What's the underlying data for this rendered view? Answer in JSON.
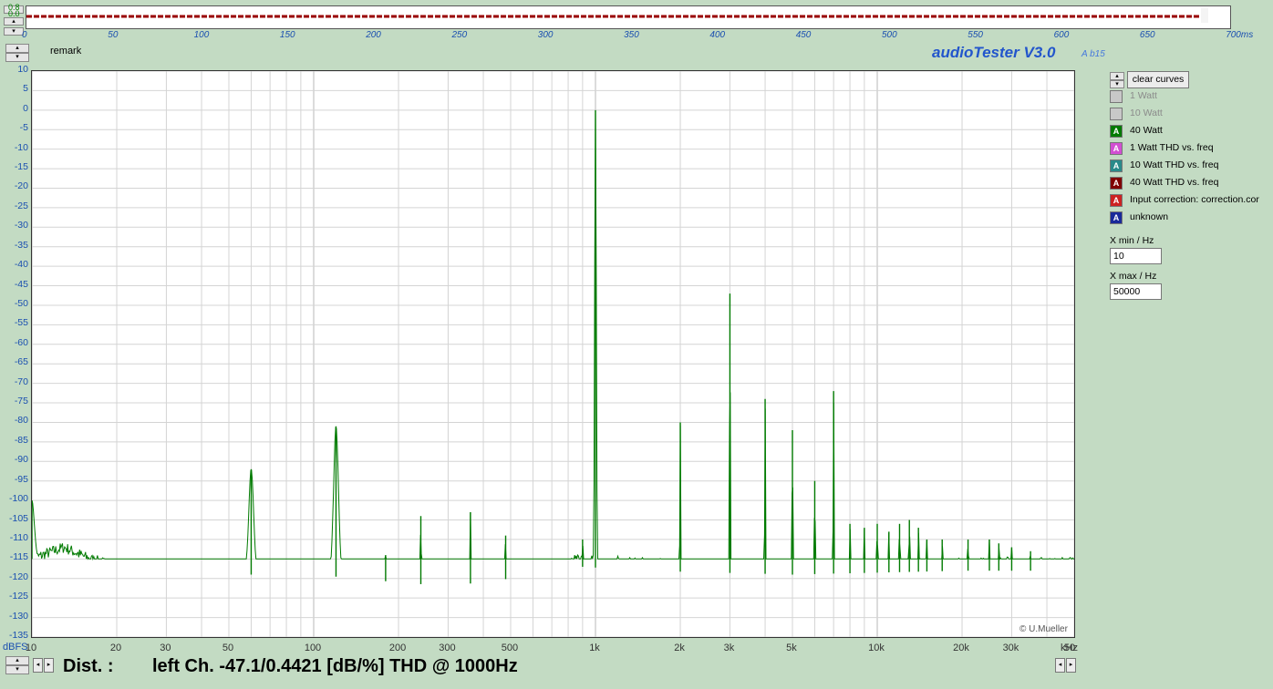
{
  "top_strip": {
    "tick_labels": [
      "0",
      "50",
      "100",
      "150",
      "200",
      "250",
      "300",
      "350",
      "400",
      "450",
      "500",
      "550",
      "600",
      "650",
      "700ms"
    ],
    "y_labels": [
      "0.8",
      "0.0"
    ],
    "line_color": "#990000"
  },
  "remark": "remark",
  "app": {
    "title": "audioTester V3.0",
    "version": "A b15"
  },
  "legend": {
    "clear_label": "clear curves",
    "items": [
      {
        "label": "1 Watt",
        "color": "#c8c8c8",
        "enabled": false,
        "glyph": ""
      },
      {
        "label": "10 Watt",
        "color": "#c8c8c8",
        "enabled": false,
        "glyph": ""
      },
      {
        "label": "40 Watt",
        "color": "#007a00",
        "enabled": true,
        "glyph": "A"
      },
      {
        "label": "1 Watt THD vs. freq",
        "color": "#d24fd2",
        "enabled": true,
        "glyph": "A"
      },
      {
        "label": "10 Watt THD vs. freq",
        "color": "#2a8a8a",
        "enabled": true,
        "glyph": "A"
      },
      {
        "label": "40 Watt THD vs. freq",
        "color": "#800000",
        "enabled": true,
        "glyph": "A"
      },
      {
        "label": "Input correction: correction.cor",
        "color": "#cc2222",
        "enabled": true,
        "glyph": "A"
      },
      {
        "label": "unknown",
        "color": "#1a2a9a",
        "enabled": true,
        "glyph": "A"
      }
    ]
  },
  "controls": {
    "xmin_label": "X min / Hz",
    "xmin_value": "10",
    "xmax_label": "X max / Hz",
    "xmax_value": "50000"
  },
  "bottom": {
    "dist_label": "Dist. :",
    "dist_text": "left Ch. -47.1/0.4421 [dB/%] THD @ 1000Hz"
  },
  "copyright": "© U.Mueller",
  "chart_data": {
    "type": "line",
    "x_scale": "log",
    "xlim": [
      10,
      50000
    ],
    "ylim": [
      -135,
      10
    ],
    "grid": true,
    "ylabel": "dBFS",
    "xlabel": "kHz",
    "x_tick_labels": [
      {
        "v": 10,
        "t": "10"
      },
      {
        "v": 20,
        "t": "20"
      },
      {
        "v": 30,
        "t": "30"
      },
      {
        "v": 50,
        "t": "50"
      },
      {
        "v": 100,
        "t": "100"
      },
      {
        "v": 200,
        "t": "200"
      },
      {
        "v": 300,
        "t": "300"
      },
      {
        "v": 500,
        "t": "500"
      },
      {
        "v": 1000,
        "t": "1k"
      },
      {
        "v": 2000,
        "t": "2k"
      },
      {
        "v": 3000,
        "t": "3k"
      },
      {
        "v": 5000,
        "t": "5k"
      },
      {
        "v": 10000,
        "t": "10k"
      },
      {
        "v": 20000,
        "t": "20k"
      },
      {
        "v": 30000,
        "t": "30k"
      },
      {
        "v": 50000,
        "t": "50"
      }
    ],
    "y_tick_labels": [
      "10",
      "5",
      "0",
      "-5",
      "-10",
      "-15",
      "-20",
      "-25",
      "-30",
      "-35",
      "-40",
      "-45",
      "-50",
      "-55",
      "-60",
      "-65",
      "-70",
      "-75",
      "-80",
      "-85",
      "-90",
      "-95",
      "-100",
      "-105",
      "-110",
      "-115",
      "-120",
      "-125",
      "-130",
      "-135"
    ],
    "series": [
      {
        "color": "#007a00",
        "noise_floor_db": -119,
        "floor_profile": [
          [
            10,
            -115
          ],
          [
            13,
            -112
          ],
          [
            16,
            -115
          ],
          [
            20,
            -117
          ],
          [
            25,
            -120
          ],
          [
            30,
            -116
          ],
          [
            40,
            -118
          ],
          [
            60,
            -119
          ],
          [
            100,
            -119
          ],
          [
            200,
            -121
          ],
          [
            300,
            -122
          ],
          [
            500,
            -120
          ],
          [
            900,
            -117
          ],
          [
            1500,
            -118
          ],
          [
            5000,
            -119
          ],
          [
            20000,
            -118
          ],
          [
            50000,
            -118
          ]
        ],
        "peaks": [
          {
            "f": 10,
            "db": -100
          },
          {
            "f": 60,
            "db": -92
          },
          {
            "f": 120,
            "db": -81
          },
          {
            "f": 180,
            "db": -114
          },
          {
            "f": 240,
            "db": -104
          },
          {
            "f": 360,
            "db": -103
          },
          {
            "f": 480,
            "db": -109
          },
          {
            "f": 900,
            "db": -110
          },
          {
            "f": 1000,
            "db": 0
          },
          {
            "f": 2000,
            "db": -80
          },
          {
            "f": 3000,
            "db": -47
          },
          {
            "f": 4000,
            "db": -74
          },
          {
            "f": 5000,
            "db": -82
          },
          {
            "f": 6000,
            "db": -95
          },
          {
            "f": 7000,
            "db": -72
          },
          {
            "f": 8000,
            "db": -106
          },
          {
            "f": 9000,
            "db": -107
          },
          {
            "f": 10000,
            "db": -106
          },
          {
            "f": 11000,
            "db": -108
          },
          {
            "f": 12000,
            "db": -106
          },
          {
            "f": 13000,
            "db": -105
          },
          {
            "f": 14000,
            "db": -107
          },
          {
            "f": 15000,
            "db": -110
          },
          {
            "f": 17000,
            "db": -110
          },
          {
            "f": 21000,
            "db": -110
          },
          {
            "f": 25000,
            "db": -110
          },
          {
            "f": 27000,
            "db": -111
          },
          {
            "f": 30000,
            "db": -112
          },
          {
            "f": 35000,
            "db": -113
          }
        ]
      }
    ]
  }
}
